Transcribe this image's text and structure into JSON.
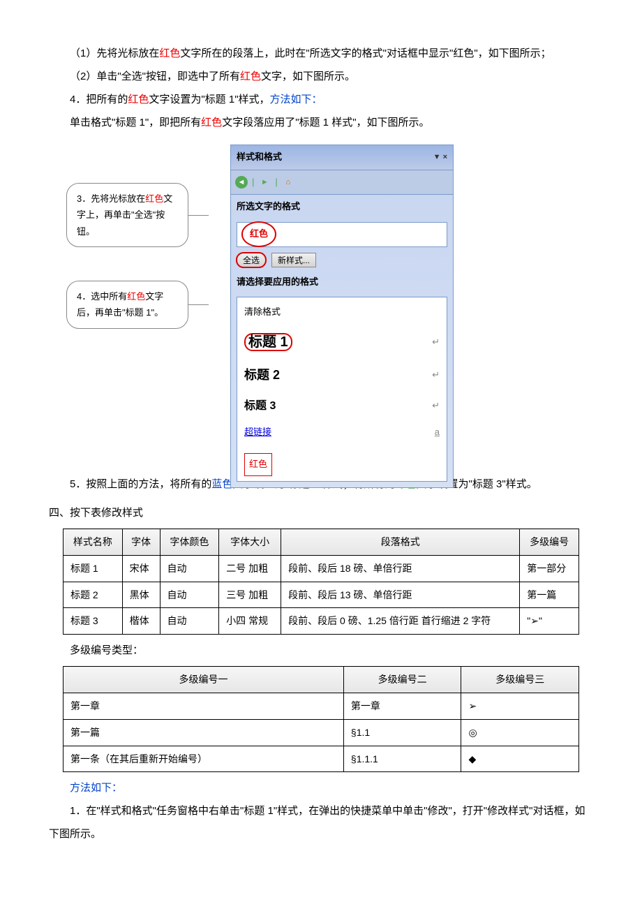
{
  "paragraphs": {
    "p1_a": "（1）先将光标放在",
    "p1_red": "红色",
    "p1_b": "文字所在的段落上，此时在\"所选文字的格式\"对话框中显示\"红色\"，如下图所示；",
    "p2_a": "（2）单击\"全选\"按钮，即选中了所有",
    "p2_red": "红色",
    "p2_b": "文字，如下图所示。",
    "p3_a": "4．把所有的",
    "p3_red": "红色",
    "p3_b": "文字设置为\"标题 1\"样式，",
    "p3_blue": "方法如下：",
    "p4_a": "单击格式\"标题 1\"，即把所有",
    "p4_red": "红色",
    "p4_b": "文字段落应用了\"标题 1 样式\"，如下图所示。",
    "p5_a": "5．按照上面的方法，将所有的",
    "p5_blue": "蓝色",
    "p5_b": "文字设置为\"标题 2\"样式；将所有的",
    "p5_green": "绿色",
    "p5_c": "文字设置为\"标题 3\"样式。",
    "sec4": "四、按下表修改样式",
    "num_type_label": "多级编号类型：",
    "method_label": "方法如下：",
    "p6": "1．在\"样式和格式\"任务窗格中右单击\"标题 1\"样式，在弹出的快捷菜单中单击\"修改\"，打开\"修改样式\"对话框，如下图所示。"
  },
  "callouts": {
    "c1_a": "3．先将光标放在",
    "c1_red": "红色",
    "c1_b": "文字上，再单击\"全选\"按钮。",
    "c2_a": "4．选中所有",
    "c2_red": "红色",
    "c2_b": "文字后，再单击\"标题 1\"。"
  },
  "panel": {
    "title": "样式和格式",
    "close": "▼ ×",
    "section1": "所选文字的格式",
    "current": "红色",
    "btn_selectall": "全选",
    "btn_newstyle": "新样式...",
    "section2": "请选择要应用的格式",
    "items": {
      "clear": "清除格式",
      "h1": "标题 1",
      "h2": "标题 2",
      "h3": "标题 3",
      "link": "超链接",
      "red": "红色"
    },
    "link_mark": "a",
    "para_mark": "↵"
  },
  "styles_table": {
    "headers": [
      "样式名称",
      "字体",
      "字体颜色",
      "字体大小",
      "段落格式",
      "多级编号"
    ],
    "rows": [
      [
        "标题 1",
        "宋体",
        "自动",
        "二号 加粗",
        "段前、段后 18 磅、单倍行距",
        "第一部分"
      ],
      [
        "标题 2",
        "黑体",
        "自动",
        "三号 加粗",
        "段前、段后 13 磅、单倍行距",
        "第一篇"
      ],
      [
        "标题 3",
        "楷体",
        "自动",
        "小四 常规",
        "段前、段后 0 磅、1.25 倍行距 首行缩进 2 字符",
        "\"➢\""
      ]
    ]
  },
  "numbering_table": {
    "headers": [
      "多级编号一",
      "多级编号二",
      "多级编号三"
    ],
    "rows": [
      [
        "第一章",
        "第一章",
        "➢"
      ],
      [
        "第一篇",
        "§1.1",
        "◎"
      ],
      [
        "第一条（在其后重新开始编号）",
        "§1.1.1",
        "◆"
      ]
    ]
  }
}
